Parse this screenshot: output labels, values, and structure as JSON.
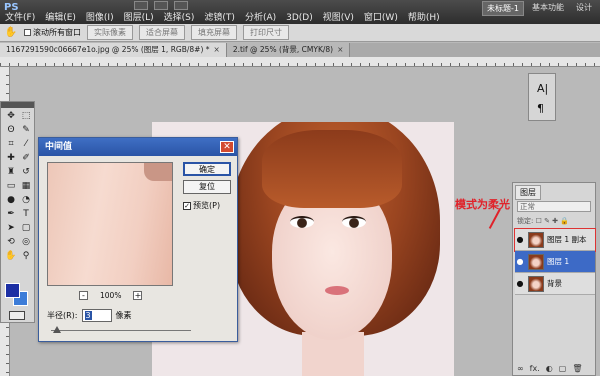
{
  "app": {
    "logo": "PS"
  },
  "menu": [
    "文件(F)",
    "编辑(E)",
    "图像(I)",
    "图层(L)",
    "选择(S)",
    "滤镜(T)",
    "分析(A)",
    "3D(D)",
    "视图(V)",
    "窗口(W)",
    "帮助(H)"
  ],
  "workspace": {
    "active": "未标题-1",
    "other": "基本功能",
    "third": "设计"
  },
  "options": {
    "scroll_all_label": "滚动所有窗口",
    "buttons": [
      "实际像素",
      "适合屏幕",
      "填充屏幕",
      "打印尺寸"
    ]
  },
  "tabs": [
    {
      "label": "1167291590c06667e1o.jpg @ 25% (图层 1, RGB/8#) *",
      "close": "×"
    },
    {
      "label": "2.tif @ 25% (背景, CMYK/8)",
      "close": "×"
    }
  ],
  "char_panel": {
    "a": "A|",
    "b": "¶"
  },
  "dialog": {
    "title": "中间值",
    "close": "✕",
    "ok": "确定",
    "reset": "复位",
    "preview_label": "预览(P)",
    "preview_checked": "✓",
    "zoom": "100%",
    "zoom_minus": "-",
    "zoom_plus": "+",
    "radius_label": "半径(R):",
    "radius_value": "3",
    "radius_unit": "像素"
  },
  "layers": {
    "tab": "图层",
    "blend_mode": "正常",
    "lock_label": "锁定: ☐ ✎ ✚ 🔒",
    "items": [
      {
        "name": "图层 1 副本",
        "eye": "●"
      },
      {
        "name": "图层 1",
        "eye": "●"
      },
      {
        "name": "背景",
        "eye": "●"
      }
    ],
    "footer": [
      "∞",
      "fx.",
      "◐",
      "▢",
      "🗑"
    ]
  },
  "annotation": "模式为柔光",
  "colors": {
    "foreground": "#1c2fa4",
    "background": "#3c7cd8",
    "accent": "#2a54a6",
    "annotation": "#e0222a"
  }
}
